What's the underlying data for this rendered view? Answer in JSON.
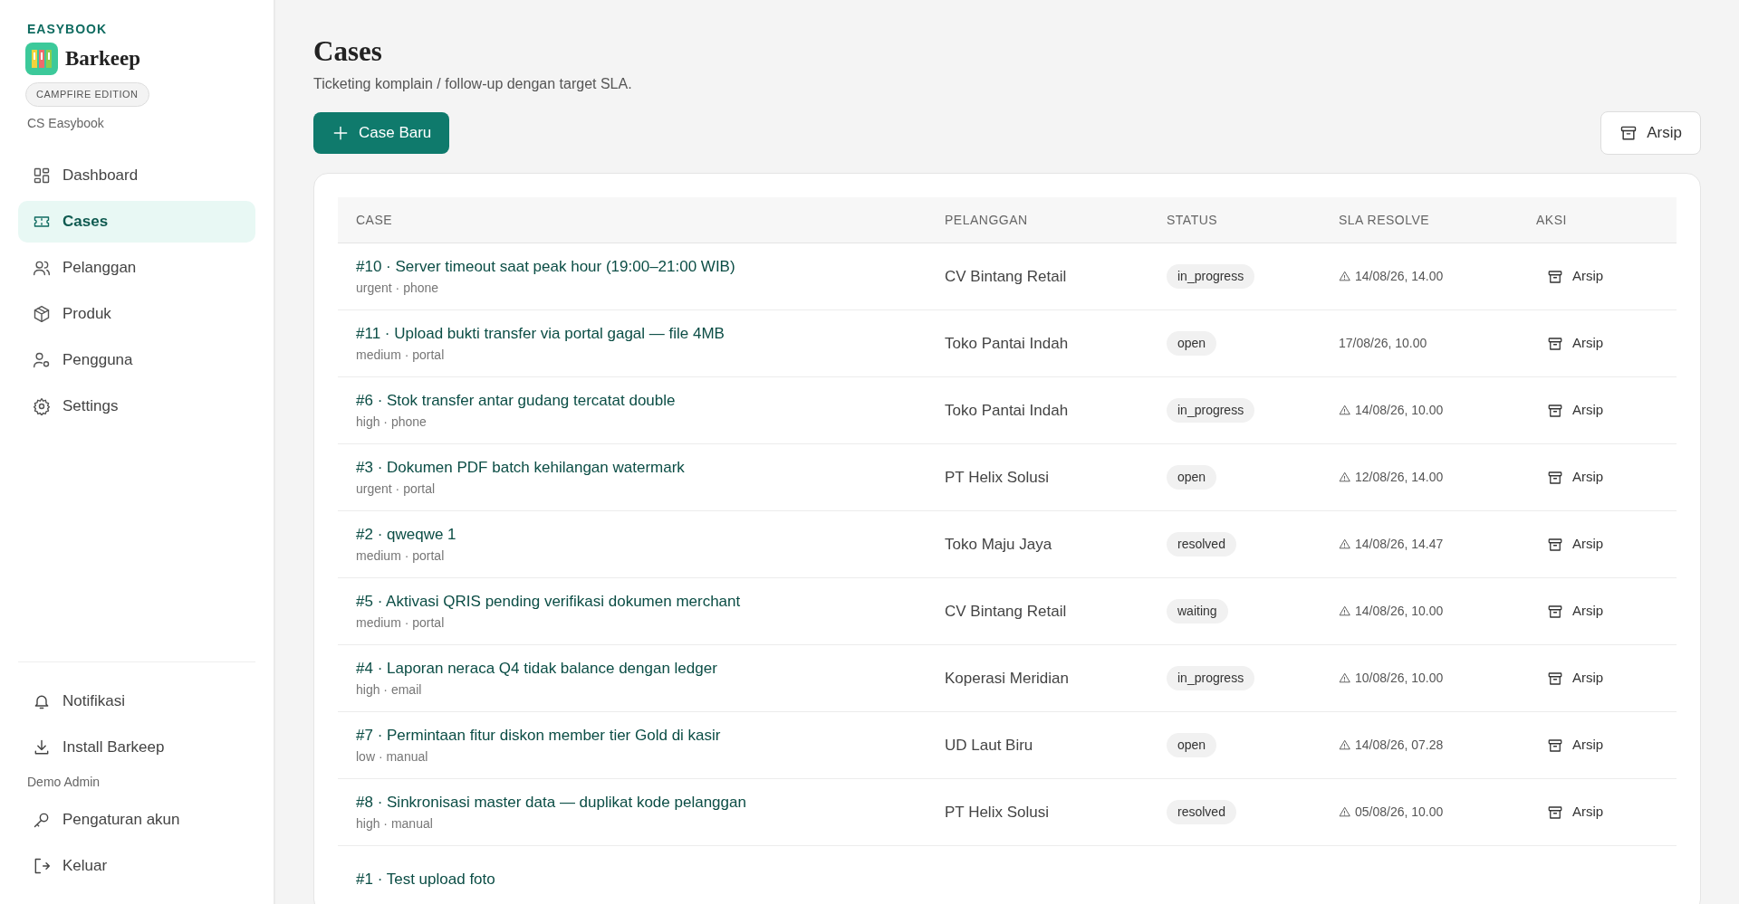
{
  "brand": {
    "org": "EASYBOOK",
    "name": "Barkeep",
    "edition": "CAMPFIRE EDITION",
    "workspace": "CS Easybook"
  },
  "nav": [
    {
      "label": "Dashboard",
      "selected": false
    },
    {
      "label": "Cases",
      "selected": true
    },
    {
      "label": "Pelanggan",
      "selected": false
    },
    {
      "label": "Produk",
      "selected": false
    },
    {
      "label": "Pengguna",
      "selected": false
    },
    {
      "label": "Settings",
      "selected": false
    }
  ],
  "footer_nav": [
    {
      "label": "Notifikasi"
    },
    {
      "label": "Install Barkeep"
    }
  ],
  "user": "Demo Admin",
  "account_nav": [
    {
      "label": "Pengaturan akun"
    },
    {
      "label": "Keluar"
    }
  ],
  "page": {
    "title": "Cases",
    "subtitle": "Ticketing komplain / follow-up dengan target SLA."
  },
  "new_button": "Case Baru",
  "archive_button": "Arsip",
  "table": {
    "columns": [
      "CASE",
      "PELANGGAN",
      "STATUS",
      "SLA RESOLVE",
      "AKSI"
    ],
    "rows": [
      {
        "title": "#10 · Server timeout saat peak hour (19:00–21:00 WIB)",
        "meta": "urgent · phone",
        "customer": "CV Bintang Retail",
        "status": "in_progress",
        "sla": "14/08/26, 14.00",
        "overdue": true,
        "action": "Arsip"
      },
      {
        "title": "#11 · Upload bukti transfer via portal gagal — file 4MB",
        "meta": "medium · portal",
        "customer": "Toko Pantai Indah",
        "status": "open",
        "sla": "17/08/26, 10.00",
        "overdue": false,
        "action": "Arsip"
      },
      {
        "title": "#6 · Stok transfer antar gudang tercatat double",
        "meta": "high · phone",
        "customer": "Toko Pantai Indah",
        "status": "in_progress",
        "sla": "14/08/26, 10.00",
        "overdue": true,
        "action": "Arsip"
      },
      {
        "title": "#3 · Dokumen PDF batch kehilangan watermark",
        "meta": "urgent · portal",
        "customer": "PT Helix Solusi",
        "status": "open",
        "sla": "12/08/26, 14.00",
        "overdue": true,
        "action": "Arsip"
      },
      {
        "title": "#2 · qweqwe 1",
        "meta": "medium · portal",
        "customer": "Toko Maju Jaya",
        "status": "resolved",
        "sla": "14/08/26, 14.47",
        "overdue": true,
        "action": "Arsip"
      },
      {
        "title": "#5 · Aktivasi QRIS pending verifikasi dokumen merchant",
        "meta": "medium · portal",
        "customer": "CV Bintang Retail",
        "status": "waiting",
        "sla": "14/08/26, 10.00",
        "overdue": true,
        "action": "Arsip"
      },
      {
        "title": "#4 · Laporan neraca Q4 tidak balance dengan ledger",
        "meta": "high · email",
        "customer": "Koperasi Meridian",
        "status": "in_progress",
        "sla": "10/08/26, 10.00",
        "overdue": true,
        "action": "Arsip"
      },
      {
        "title": "#7 · Permintaan fitur diskon member tier Gold di kasir",
        "meta": "low · manual",
        "customer": "UD Laut Biru",
        "status": "open",
        "sla": "14/08/26, 07.28",
        "overdue": true,
        "action": "Arsip"
      },
      {
        "title": "#8 · Sinkronisasi master data — duplikat kode pelanggan",
        "meta": "high · manual",
        "customer": "PT Helix Solusi",
        "status": "resolved",
        "sla": "05/08/26, 10.00",
        "overdue": true,
        "action": "Arsip"
      },
      {
        "title": "#1 · Test upload foto"
      }
    ]
  }
}
